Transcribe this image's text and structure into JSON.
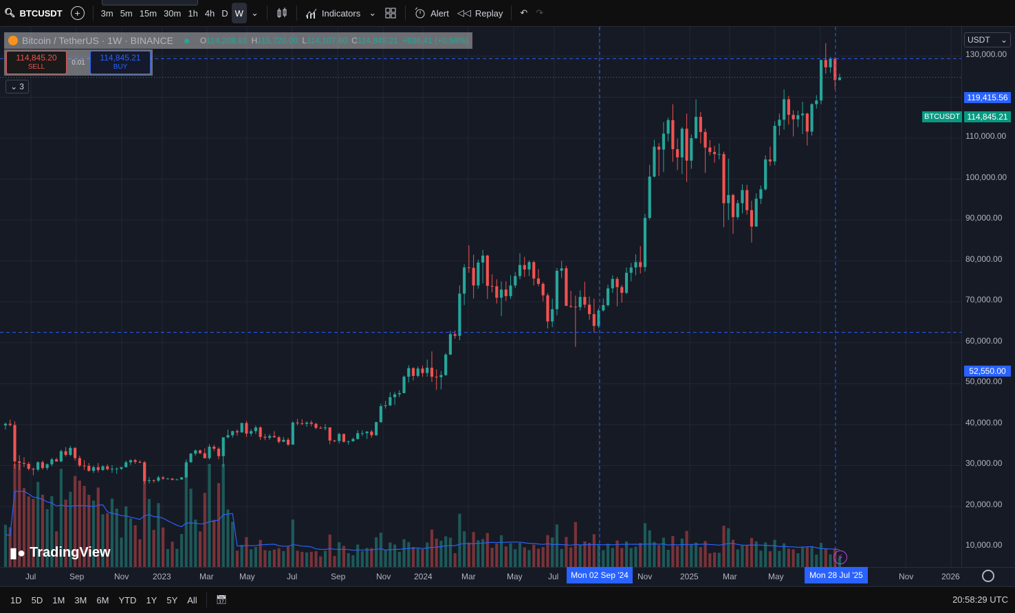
{
  "topbar": {
    "symbol": "BTCUSDT",
    "timeframes": [
      "3m",
      "5m",
      "15m",
      "30m",
      "1h",
      "4h",
      "D",
      "W"
    ],
    "active_timeframe": "W",
    "indicators_label": "Indicators",
    "alert_label": "Alert",
    "replay_label": "Replay"
  },
  "legend": {
    "name": "Bitcoin / TetherUS · 1W · BINANCE",
    "o_label": "O",
    "o": "114,208.81",
    "h_label": "H",
    "h": "115,720.00",
    "l_label": "L",
    "l": "114,107.60",
    "c_label": "C",
    "c": "114,845.21",
    "change": "+636.41 (+0.56%)"
  },
  "trade": {
    "sell_price": "114,845.20",
    "sell_label": "SELL",
    "spread": "0.01",
    "buy_price": "114,845.21",
    "buy_label": "BUY"
  },
  "collapse_count": "3",
  "currency": "USDT",
  "price_axis": {
    "labels": [
      "130,000.00",
      "110,000.00",
      "100,000.00",
      "90,000.00",
      "80,000.00",
      "70,000.00",
      "60,000.00",
      "50,000.00",
      "40,000.00",
      "30,000.00",
      "20,000.00",
      "10,000.00"
    ],
    "hover_high": "119,415.56",
    "current_symbol": "BTCUSDT",
    "current_price": "114,845.21",
    "hover_low": "52,550.00"
  },
  "time_axis": {
    "labels": [
      "Jul",
      "Sep",
      "Nov",
      "2023",
      "Mar",
      "May",
      "Jul",
      "Sep",
      "Nov",
      "2024",
      "Mar",
      "May",
      "Jul",
      "Nov",
      "2025",
      "Mar",
      "May",
      "Nov",
      "2026"
    ],
    "crosshair_1": "Mon 02 Sep '24",
    "crosshair_2": "Mon 28 Jul '25"
  },
  "logo_text": "TradingView",
  "bottombar": {
    "ranges": [
      "1D",
      "5D",
      "1M",
      "3M",
      "6M",
      "YTD",
      "1Y",
      "5Y",
      "All"
    ],
    "clock": "20:58:29 UTC"
  },
  "colors": {
    "up": "#26a69a",
    "down": "#ef5350",
    "volume_ma": "#2962ff",
    "crosshair": "#2962ff"
  },
  "chart_data": {
    "type": "candlestick",
    "interval": "1W",
    "y_unit": "USDT",
    "ylim": [
      0,
      135000
    ],
    "candles_ohlc": [
      [
        29800,
        30500,
        28800,
        30200
      ],
      [
        30200,
        31200,
        29600,
        29900
      ],
      [
        29900,
        30800,
        19200,
        21000
      ],
      [
        21000,
        22500,
        18900,
        20600
      ],
      [
        20600,
        22000,
        19600,
        20400
      ],
      [
        20400,
        20900,
        18800,
        19200
      ],
      [
        19200,
        19500,
        17600,
        19000
      ],
      [
        19000,
        21000,
        18600,
        20800
      ],
      [
        20800,
        21200,
        19000,
        19400
      ],
      [
        19400,
        20500,
        18900,
        20300
      ],
      [
        20300,
        21900,
        19800,
        21500
      ],
      [
        21500,
        21900,
        20900,
        21000
      ],
      [
        21000,
        23900,
        20800,
        23500
      ],
      [
        23500,
        24500,
        22200,
        22600
      ],
      [
        22600,
        24800,
        22300,
        24300
      ],
      [
        24300,
        24500,
        21200,
        21800
      ],
      [
        21800,
        22400,
        19600,
        20000
      ],
      [
        20000,
        21300,
        18900,
        19900
      ],
      [
        19900,
        20600,
        18500,
        18700
      ],
      [
        18700,
        20000,
        18200,
        19600
      ],
      [
        19600,
        20600,
        18300,
        18900
      ],
      [
        18900,
        20100,
        18700,
        19800
      ],
      [
        19800,
        20300,
        18800,
        19100
      ],
      [
        19100,
        20100,
        18200,
        19200
      ],
      [
        19200,
        19600,
        18000,
        19200
      ],
      [
        19200,
        19600,
        18900,
        19600
      ],
      [
        19600,
        21200,
        19500,
        20800
      ],
      [
        20800,
        21500,
        20100,
        21300
      ],
      [
        21300,
        21600,
        20400,
        20900
      ],
      [
        20900,
        21300,
        20600,
        20800
      ],
      [
        20800,
        21100,
        15500,
        16200
      ],
      [
        16200,
        17200,
        15600,
        16400
      ],
      [
        16400,
        16600,
        15800,
        16300
      ],
      [
        16300,
        17500,
        16000,
        17100
      ],
      [
        17100,
        17400,
        16500,
        16800
      ],
      [
        16800,
        17000,
        16700,
        16800
      ],
      [
        16800,
        16900,
        16400,
        16500
      ],
      [
        16500,
        16800,
        16500,
        16600
      ],
      [
        16600,
        17200,
        16500,
        17100
      ],
      [
        17100,
        21500,
        17000,
        20800
      ],
      [
        20800,
        23100,
        20700,
        22900
      ],
      [
        22900,
        23900,
        22400,
        23700
      ],
      [
        23700,
        23900,
        22800,
        23000
      ],
      [
        23000,
        24200,
        21700,
        21800
      ],
      [
        21800,
        25200,
        21400,
        24600
      ],
      [
        24600,
        25100,
        23500,
        24100
      ],
      [
        24100,
        24500,
        21500,
        22300
      ],
      [
        22300,
        26500,
        19600,
        26900
      ],
      [
        26900,
        28800,
        26600,
        27400
      ],
      [
        27400,
        28500,
        26800,
        28400
      ],
      [
        28400,
        28800,
        27300,
        28100
      ],
      [
        28100,
        30400,
        28000,
        30400
      ],
      [
        30400,
        30900,
        27000,
        27800
      ],
      [
        27800,
        28900,
        27200,
        28400
      ],
      [
        28400,
        29800,
        27700,
        29300
      ],
      [
        29300,
        29600,
        26300,
        27000
      ],
      [
        27000,
        27700,
        26200,
        26800
      ],
      [
        26800,
        27700,
        26300,
        27200
      ],
      [
        27200,
        28400,
        26800,
        26900
      ],
      [
        26900,
        27200,
        25400,
        25800
      ],
      [
        25800,
        27000,
        25700,
        26300
      ],
      [
        26300,
        26800,
        24800,
        25100
      ],
      [
        25100,
        30800,
        25100,
        30500
      ],
      [
        30500,
        31400,
        29800,
        30300
      ],
      [
        30300,
        31300,
        29900,
        30200
      ],
      [
        30200,
        30800,
        29500,
        30500
      ],
      [
        30500,
        31000,
        29600,
        30200
      ],
      [
        30200,
        30400,
        28900,
        29200
      ],
      [
        29200,
        29600,
        29000,
        29100
      ],
      [
        29100,
        30100,
        28600,
        29300
      ],
      [
        29300,
        29400,
        25200,
        26100
      ],
      [
        26100,
        26300,
        25700,
        26000
      ],
      [
        26000,
        28000,
        25400,
        27700
      ],
      [
        27700,
        27800,
        25600,
        25800
      ],
      [
        25800,
        26100,
        25100,
        25900
      ],
      [
        25900,
        26800,
        26100,
        26500
      ],
      [
        26500,
        28600,
        26300,
        27900
      ],
      [
        27900,
        28600,
        27200,
        27900
      ],
      [
        27900,
        28400,
        26500,
        28300
      ],
      [
        28300,
        28700,
        26800,
        27400
      ],
      [
        27400,
        30700,
        27200,
        30600
      ],
      [
        30600,
        35100,
        30400,
        34500
      ],
      [
        34500,
        35800,
        33900,
        34700
      ],
      [
        34700,
        37900,
        34500,
        36700
      ],
      [
        36700,
        38000,
        34800,
        37400
      ],
      [
        37400,
        38400,
        36700,
        37700
      ],
      [
        37700,
        42000,
        37600,
        41700
      ],
      [
        41700,
        44500,
        40300,
        43800
      ],
      [
        43800,
        44000,
        40800,
        41900
      ],
      [
        41900,
        44200,
        41500,
        43700
      ],
      [
        43700,
        44400,
        41700,
        42600
      ],
      [
        42600,
        45900,
        41700,
        43900
      ],
      [
        43900,
        47900,
        40400,
        41700
      ],
      [
        41700,
        43500,
        38500,
        41600
      ],
      [
        41600,
        43100,
        38600,
        42100
      ],
      [
        42100,
        47500,
        41900,
        47100
      ],
      [
        47100,
        52900,
        47000,
        52100
      ],
      [
        52100,
        53000,
        51000,
        51700
      ],
      [
        51700,
        64000,
        50600,
        62000
      ],
      [
        62000,
        69200,
        59200,
        68400
      ],
      [
        68400,
        73800,
        67100,
        68300
      ],
      [
        68300,
        71500,
        60800,
        64000
      ],
      [
        64000,
        70300,
        63200,
        69600
      ],
      [
        69600,
        72700,
        64500,
        71300
      ],
      [
        71300,
        71500,
        60700,
        63900
      ],
      [
        63900,
        66700,
        62300,
        63800
      ],
      [
        63800,
        65500,
        59600,
        61000
      ],
      [
        61000,
        65000,
        56500,
        63000
      ],
      [
        63000,
        65000,
        60200,
        61400
      ],
      [
        61400,
        66500,
        60700,
        64000
      ],
      [
        64000,
        67300,
        63400,
        66300
      ],
      [
        66300,
        71900,
        65500,
        69000
      ],
      [
        69000,
        71000,
        66100,
        67900
      ],
      [
        67900,
        70100,
        66300,
        69700
      ],
      [
        69700,
        70000,
        64000,
        65700
      ],
      [
        65700,
        68000,
        63800,
        64400
      ],
      [
        64400,
        64800,
        60100,
        61600
      ],
      [
        61600,
        62100,
        53500,
        55200
      ],
      [
        55200,
        60800,
        53800,
        58200
      ],
      [
        58200,
        68300,
        56700,
        67600
      ],
      [
        67600,
        70000,
        65800,
        68200
      ],
      [
        68200,
        68800,
        60000,
        59000
      ],
      [
        59000,
        62700,
        58500,
        58800
      ],
      [
        58800,
        61500,
        49000,
        58700
      ],
      [
        58700,
        62800,
        57900,
        61200
      ],
      [
        61200,
        64900,
        58500,
        59300
      ],
      [
        59300,
        61300,
        55600,
        57000
      ],
      [
        57000,
        60800,
        52550,
        54100
      ],
      [
        54100,
        58400,
        53600,
        57900
      ],
      [
        57900,
        60800,
        57600,
        59200
      ],
      [
        59200,
        64200,
        58800,
        63300
      ],
      [
        63300,
        66500,
        62200,
        65600
      ],
      [
        65600,
        66100,
        58900,
        63600
      ],
      [
        63600,
        64100,
        59800,
        62200
      ],
      [
        62200,
        68400,
        61900,
        67100
      ],
      [
        67100,
        69500,
        65000,
        68400
      ],
      [
        68400,
        71600,
        66500,
        69700
      ],
      [
        69700,
        73600,
        66900,
        68500
      ],
      [
        68500,
        81500,
        67400,
        80500
      ],
      [
        80500,
        93500,
        80100,
        90600
      ],
      [
        90600,
        99600,
        90400,
        97900
      ],
      [
        97900,
        98800,
        90700,
        97200
      ],
      [
        97200,
        103900,
        91700,
        101100
      ],
      [
        101100,
        105000,
        99200,
        104400
      ],
      [
        104400,
        108300,
        94200,
        97300
      ],
      [
        97300,
        99900,
        92200,
        95300
      ],
      [
        95300,
        102700,
        91200,
        102300
      ],
      [
        102300,
        106000,
        89300,
        94500
      ],
      [
        94500,
        100900,
        92500,
        100000
      ],
      [
        100000,
        109500,
        99700,
        105200
      ],
      [
        105200,
        106400,
        98700,
        101500
      ],
      [
        101500,
        102300,
        91500,
        97700
      ],
      [
        97700,
        99500,
        95800,
        96600
      ],
      [
        96600,
        98100,
        94000,
        96100
      ],
      [
        96100,
        98700,
        94800,
        96100
      ],
      [
        96100,
        96700,
        78200,
        84100
      ],
      [
        84100,
        95000,
        80000,
        86100
      ],
      [
        86100,
        86400,
        76600,
        80700
      ],
      [
        80700,
        84900,
        80100,
        84100
      ],
      [
        84100,
        88700,
        81600,
        87300
      ],
      [
        87300,
        88600,
        81300,
        82400
      ],
      [
        82400,
        84700,
        74500,
        78400
      ],
      [
        78400,
        86500,
        78300,
        85200
      ],
      [
        85200,
        88400,
        83900,
        87500
      ],
      [
        87500,
        95800,
        87200,
        94800
      ],
      [
        94800,
        97900,
        93200,
        94300
      ],
      [
        94300,
        104100,
        93400,
        103000
      ],
      [
        103000,
        106000,
        100700,
        104500
      ],
      [
        104500,
        111900,
        102100,
        109500
      ],
      [
        109500,
        110300,
        103300,
        105700
      ],
      [
        105700,
        106800,
        100400,
        104600
      ],
      [
        104600,
        106700,
        102700,
        105600
      ],
      [
        105600,
        108900,
        101000,
        106000
      ],
      [
        106000,
        106200,
        98200,
        101600
      ],
      [
        101600,
        108500,
        100600,
        108300
      ],
      [
        108300,
        110500,
        107200,
        109200
      ],
      [
        109200,
        118800,
        108300,
        119100
      ],
      [
        119100,
        123200,
        115700,
        117300
      ],
      [
        117300,
        119800,
        116000,
        119400
      ],
      [
        119400,
        119800,
        112000,
        114200
      ],
      [
        114200,
        115720,
        114100,
        114845
      ]
    ],
    "volume_ma_note": ""
  }
}
